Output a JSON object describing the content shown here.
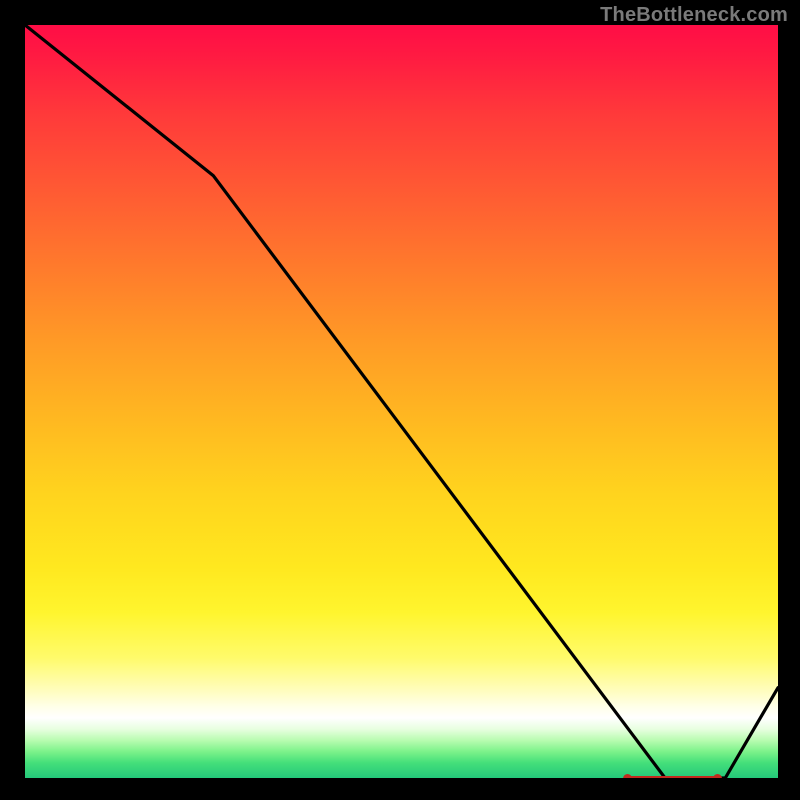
{
  "watermark": "TheBottleneck.com",
  "chart_data": {
    "type": "line",
    "title": "",
    "xlabel": "",
    "ylabel": "",
    "xlim": [
      0,
      100
    ],
    "ylim": [
      0,
      100
    ],
    "x": [
      0,
      25,
      85,
      93,
      100
    ],
    "y": [
      100,
      80,
      0,
      0,
      12
    ],
    "markers": {
      "x_start": 80,
      "x_end": 92,
      "y": 0
    },
    "background": "heat-gradient",
    "grid": false,
    "legend": false
  }
}
